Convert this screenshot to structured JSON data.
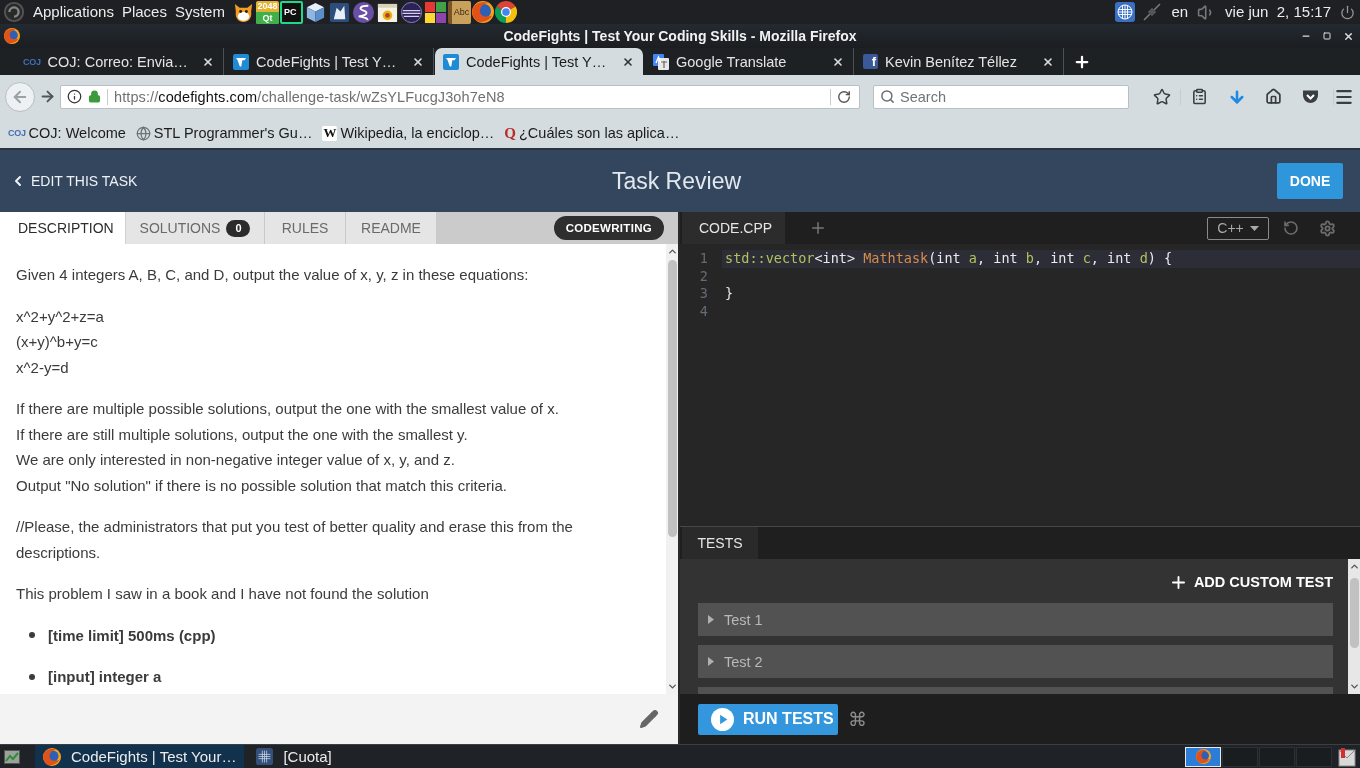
{
  "top_panel": {
    "menus": [
      "Applications",
      "Places",
      "System"
    ],
    "launchers": [
      {
        "kind": "scratch"
      },
      {
        "kind": "tile",
        "label": "2048",
        "sublabel": "Qt"
      },
      {
        "kind": "pycharm",
        "label": "PC"
      },
      {
        "kind": "cube"
      },
      {
        "kind": "document"
      },
      {
        "kind": "emacs"
      },
      {
        "kind": "calendar"
      },
      {
        "kind": "eclipse"
      },
      {
        "kind": "squares"
      },
      {
        "kind": "dictionary",
        "label": "Abc"
      },
      {
        "kind": "firefox"
      },
      {
        "kind": "chrome"
      }
    ],
    "keyboard_layout": "en",
    "clock": "vie jun  2, 15:17"
  },
  "window": {
    "title": "CodeFights | Test Your Coding Skills - Mozilla Firefox"
  },
  "tabs": [
    {
      "title": "COJ: Correo: Envia…",
      "kind": "coj",
      "icon_text": "COJ",
      "selected": false
    },
    {
      "title": "CodeFights | Test Y…",
      "kind": "codefights",
      "selected": false
    },
    {
      "title": "CodeFights | Test Y…",
      "kind": "codefights",
      "selected": true
    },
    {
      "title": "Google Translate",
      "kind": "translate",
      "selected": false
    },
    {
      "title": "Kevin Benítez Téllez",
      "kind": "facebook",
      "icon_text": "f",
      "selected": false
    }
  ],
  "navbar": {
    "url": "https://**codefights.com**/challenge-task/wZsYLFucgJ3oh7eN8",
    "search_placeholder": "Search"
  },
  "bookmarks": [
    {
      "label": "COJ: Welcome",
      "kind": "coj",
      "icon_text": "COJ"
    },
    {
      "label": "STL Programmer's Gu…",
      "kind": "globe"
    },
    {
      "label": "Wikipedia, la enciclop…",
      "kind": "wikipedia",
      "icon_text": "W"
    },
    {
      "label": "¿Cuáles son las aplica…",
      "kind": "quora",
      "icon_text": "Q"
    }
  ],
  "header": {
    "back_label": "EDIT THIS TASK",
    "title": "Task Review",
    "done_label": "DONE"
  },
  "left_panel": {
    "tabs": [
      {
        "label": "DESCRIPTION",
        "selected": true
      },
      {
        "label": "SOLUTIONS",
        "count": "0",
        "selected": false
      },
      {
        "label": "RULES",
        "selected": false
      },
      {
        "label": "README",
        "selected": false
      }
    ],
    "badge": "CODEWRITING",
    "blocks": [
      {
        "kind": "lines",
        "lines": [
          "Given 4 integers A, B, C, and D, output the value of x, y, z in these equations:"
        ]
      },
      {
        "kind": "lines",
        "lines": [
          "x^2+y^2+z=a",
          "(x+y)^b+y=c",
          "x^2-y=d"
        ]
      },
      {
        "kind": "lines",
        "lines": [
          "If there are multiple possible solutions, output the one with the smallest value of x.",
          "If there are still multiple solutions, output the one with the smallest y.",
          "We are only interested in non-negative integer value of x, y, and z.",
          "Output \"No solution\" if there is no possible solution that match this criteria."
        ]
      },
      {
        "kind": "lines",
        "lines": [
          "//Please, the administrators that put you test of better quality and erase this from the descriptions."
        ]
      },
      {
        "kind": "lines",
        "lines": [
          "This problem I saw in a book and I have not found the solution"
        ]
      },
      {
        "kind": "bullets",
        "items": [
          "[time limit] 500ms (cpp)",
          "[input] integer a"
        ]
      }
    ]
  },
  "editor": {
    "file_tab": "CODE.CPP",
    "language": "C++",
    "lines": [
      {
        "number": "1",
        "active": true,
        "tokens": [
          {
            "kind": "type",
            "text": "std::vector"
          },
          {
            "kind": "plain",
            "text": "<int> "
          },
          {
            "kind": "function",
            "text": "Mathtask"
          },
          {
            "kind": "plain",
            "text": "(int "
          },
          {
            "kind": "param",
            "text": "a"
          },
          {
            "kind": "plain",
            "text": ", int "
          },
          {
            "kind": "param",
            "text": "b"
          },
          {
            "kind": "plain",
            "text": ", int "
          },
          {
            "kind": "param",
            "text": "c"
          },
          {
            "kind": "plain",
            "text": ", int "
          },
          {
            "kind": "param",
            "text": "d"
          },
          {
            "kind": "plain",
            "text": ") {"
          }
        ]
      },
      {
        "number": "2",
        "active": false
      },
      {
        "number": "3",
        "active": false,
        "tokens": [
          {
            "kind": "plain",
            "text": "}"
          }
        ]
      },
      {
        "number": "4",
        "active": false
      }
    ]
  },
  "tests": {
    "tab": "TESTS",
    "add_label": "ADD CUSTOM TEST",
    "items": [
      {
        "label": "Test 1",
        "expanded": false
      },
      {
        "label": "Test 2",
        "expanded": false
      }
    ],
    "more_below": true,
    "run_label": "RUN TESTS",
    "shortcut": "⌘"
  },
  "taskbar": {
    "items": [
      {
        "label": "CodeFights | Test Your…",
        "kind": "firefox",
        "selected": true
      },
      {
        "label": "[Cuota]",
        "kind": "grid",
        "selected": false
      }
    ],
    "workspaces": [
      {
        "selected": true,
        "kind": "firefox"
      },
      {
        "selected": false,
        "kind": "empty"
      },
      {
        "selected": false,
        "kind": "empty"
      },
      {
        "selected": false,
        "kind": "empty"
      }
    ]
  }
}
